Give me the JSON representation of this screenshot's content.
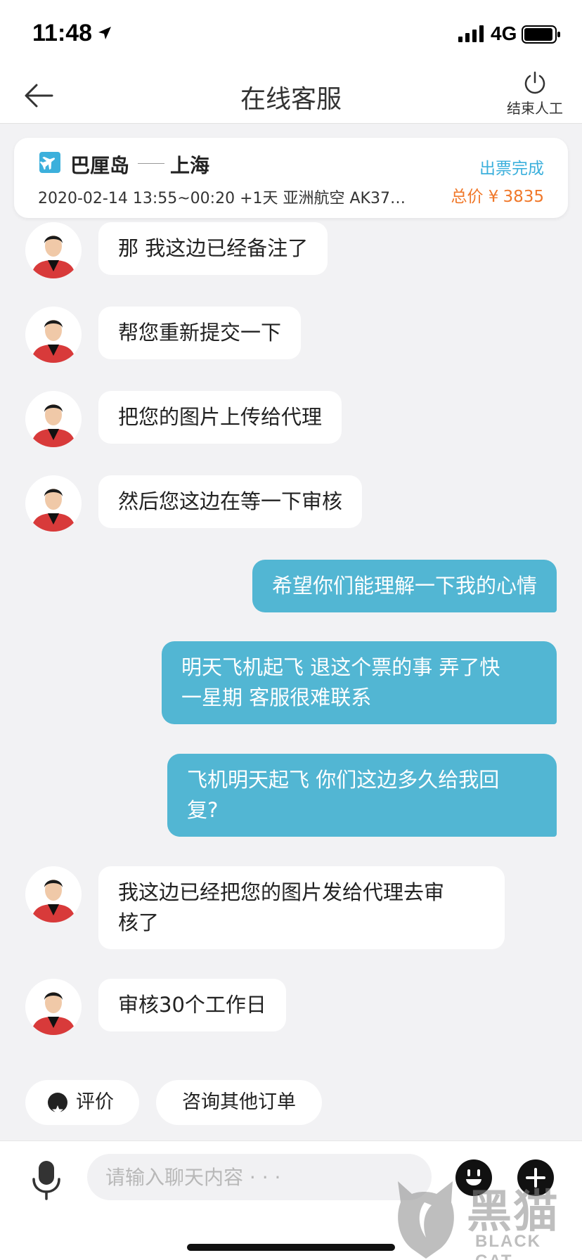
{
  "status_bar": {
    "time": "11:48",
    "network": "4G"
  },
  "nav": {
    "title": "在线客服",
    "end_label": "结束人工"
  },
  "order": {
    "from": "巴厘岛",
    "to": "上海",
    "status": "出票完成",
    "detail": "2020-02-14 13:55~00:20 +1天   亚洲航空 AK37…",
    "price_label": "总价 ¥",
    "price_value": "3835"
  },
  "messages": [
    {
      "side": "agent",
      "text": "那 我这边已经备注了"
    },
    {
      "side": "agent",
      "text": "帮您重新提交一下"
    },
    {
      "side": "agent",
      "text": "把您的图片上传给代理"
    },
    {
      "side": "agent",
      "text": "然后您这边在等一下审核"
    },
    {
      "side": "user",
      "text": "希望你们能理解一下我的心情"
    },
    {
      "side": "user",
      "line1": "明天飞机起飞 退这个票的事 弄了快",
      "line2": "一星期 客服很难联系"
    },
    {
      "side": "user",
      "line1": "飞机明天起飞 你们这边多久给我回",
      "line2": "复?"
    },
    {
      "side": "agent",
      "line1": "我这边已经把您的图片发给代理去审",
      "line2": "核了"
    },
    {
      "side": "agent",
      "text": "审核30个工作日"
    }
  ],
  "chips": {
    "rate": "评价",
    "other_orders": "咨询其他订单"
  },
  "input": {
    "placeholder": "请输入聊天内容 · · ·"
  },
  "watermark": {
    "cn": "黑猫",
    "en": "BLACK CAT"
  },
  "colors": {
    "accent": "#3cb0dc",
    "user_bubble": "#52b6d3",
    "price": "#f0782a"
  }
}
